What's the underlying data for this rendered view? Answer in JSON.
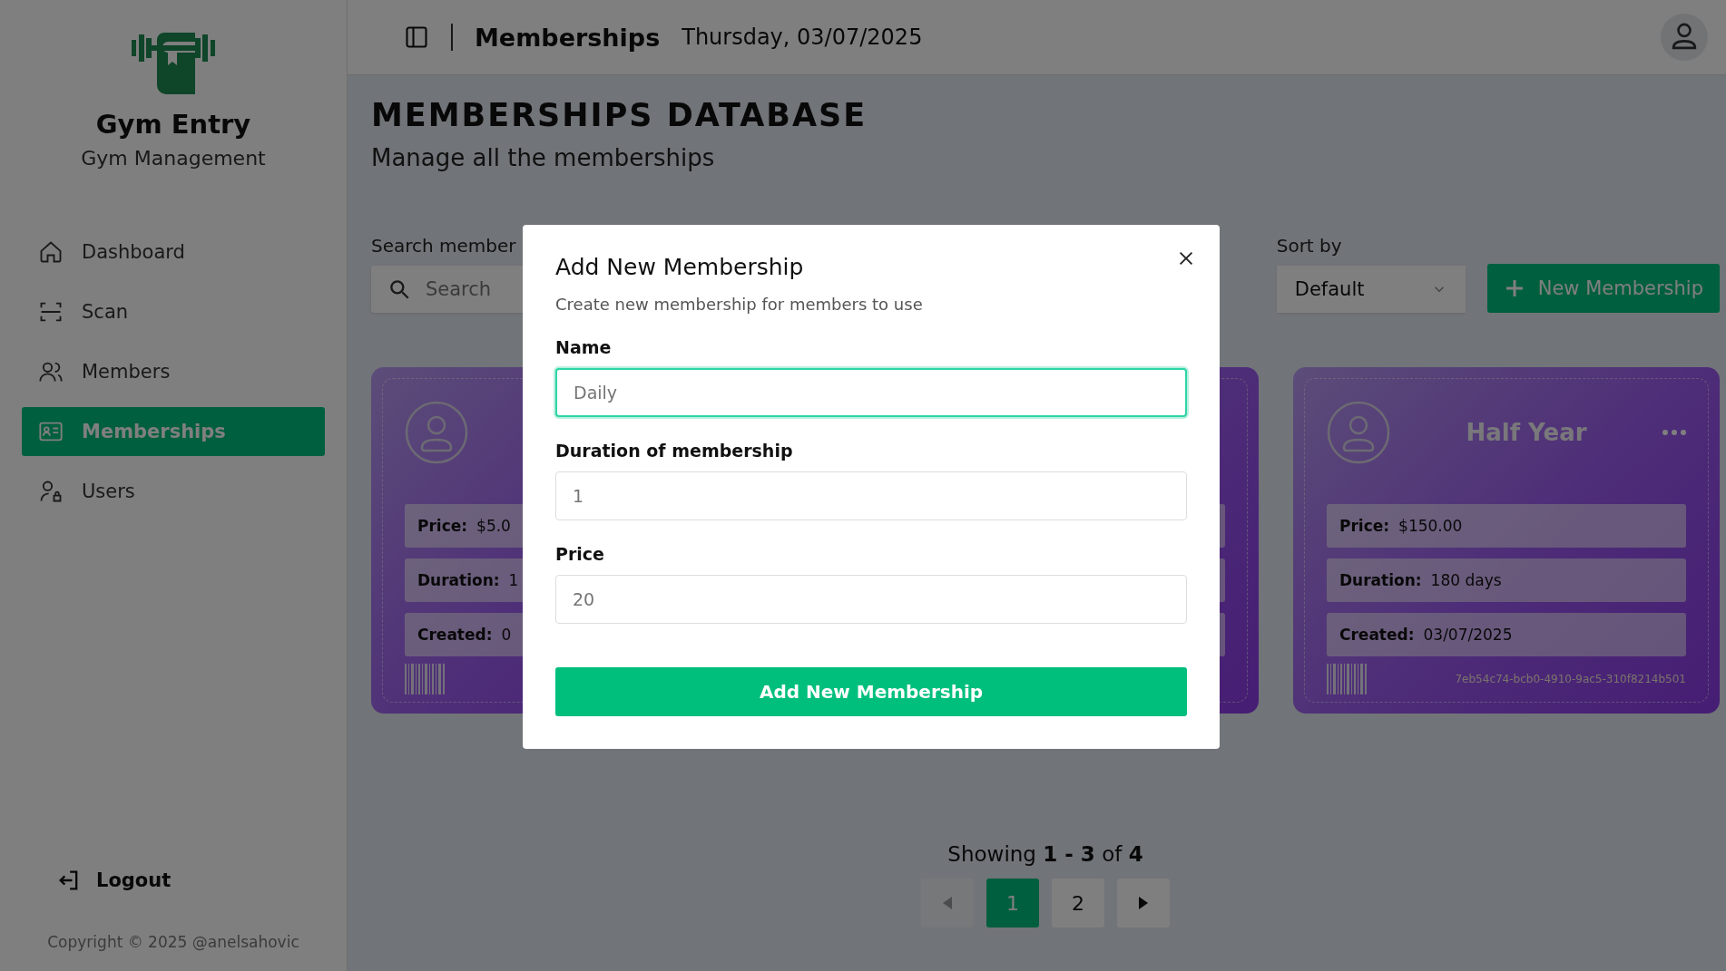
{
  "sidebar": {
    "brand": "Gym Entry",
    "subtitle": "Gym Management",
    "items": [
      {
        "label": "Dashboard",
        "kind": "home",
        "selected": false
      },
      {
        "label": "Scan",
        "kind": "scan",
        "selected": false
      },
      {
        "label": "Members",
        "kind": "users",
        "selected": false
      },
      {
        "label": "Memberships",
        "kind": "card",
        "selected": true
      },
      {
        "label": "Users",
        "kind": "userlock",
        "selected": false
      }
    ],
    "logout": "Logout",
    "copyright": "Copyright © 2025 @anelsahovic"
  },
  "header": {
    "title": "Memberships",
    "date": "Thursday, 03/07/2025"
  },
  "page": {
    "title": "MEMBERSHIPS DATABASE",
    "subtitle": "Manage all the memberships"
  },
  "search": {
    "label": "Search member",
    "placeholder": "Search"
  },
  "sort": {
    "label": "Sort by",
    "value": "Default"
  },
  "new_button": "New Membership",
  "cards": [
    {
      "kind": "membership",
      "fields": [
        {
          "label": "Price:",
          "value": "$5.0"
        },
        {
          "label": "Duration:",
          "value": "1"
        },
        {
          "label": "Created:",
          "value": "0"
        }
      ]
    },
    {
      "kind": "covered"
    },
    {
      "kind": "membership",
      "name": "Half Year",
      "fields": [
        {
          "label": "Price:",
          "value": "$150.00"
        },
        {
          "label": "Duration:",
          "value": "180 days"
        },
        {
          "label": "Created:",
          "value": "03/07/2025"
        }
      ],
      "id": "7eb54c74-bcb0-4910-9ac5-310f8214b501"
    }
  ],
  "pagination": {
    "summary": "Showing **1 - 3** of **4**",
    "prev_disabled": true,
    "next_disabled": false,
    "pages": [
      {
        "label": "1",
        "selected": true
      },
      {
        "label": "2",
        "selected": false
      }
    ]
  },
  "modal": {
    "title": "Add New Membership",
    "description": "Create new membership for members to use",
    "fields": [
      {
        "label": "Name",
        "placeholder": "Daily",
        "focused": true
      },
      {
        "label": "Duration of membership",
        "placeholder": "1",
        "focused": false
      },
      {
        "label": "Price",
        "placeholder": "20",
        "focused": false
      }
    ],
    "submit": "Add New Membership"
  }
}
